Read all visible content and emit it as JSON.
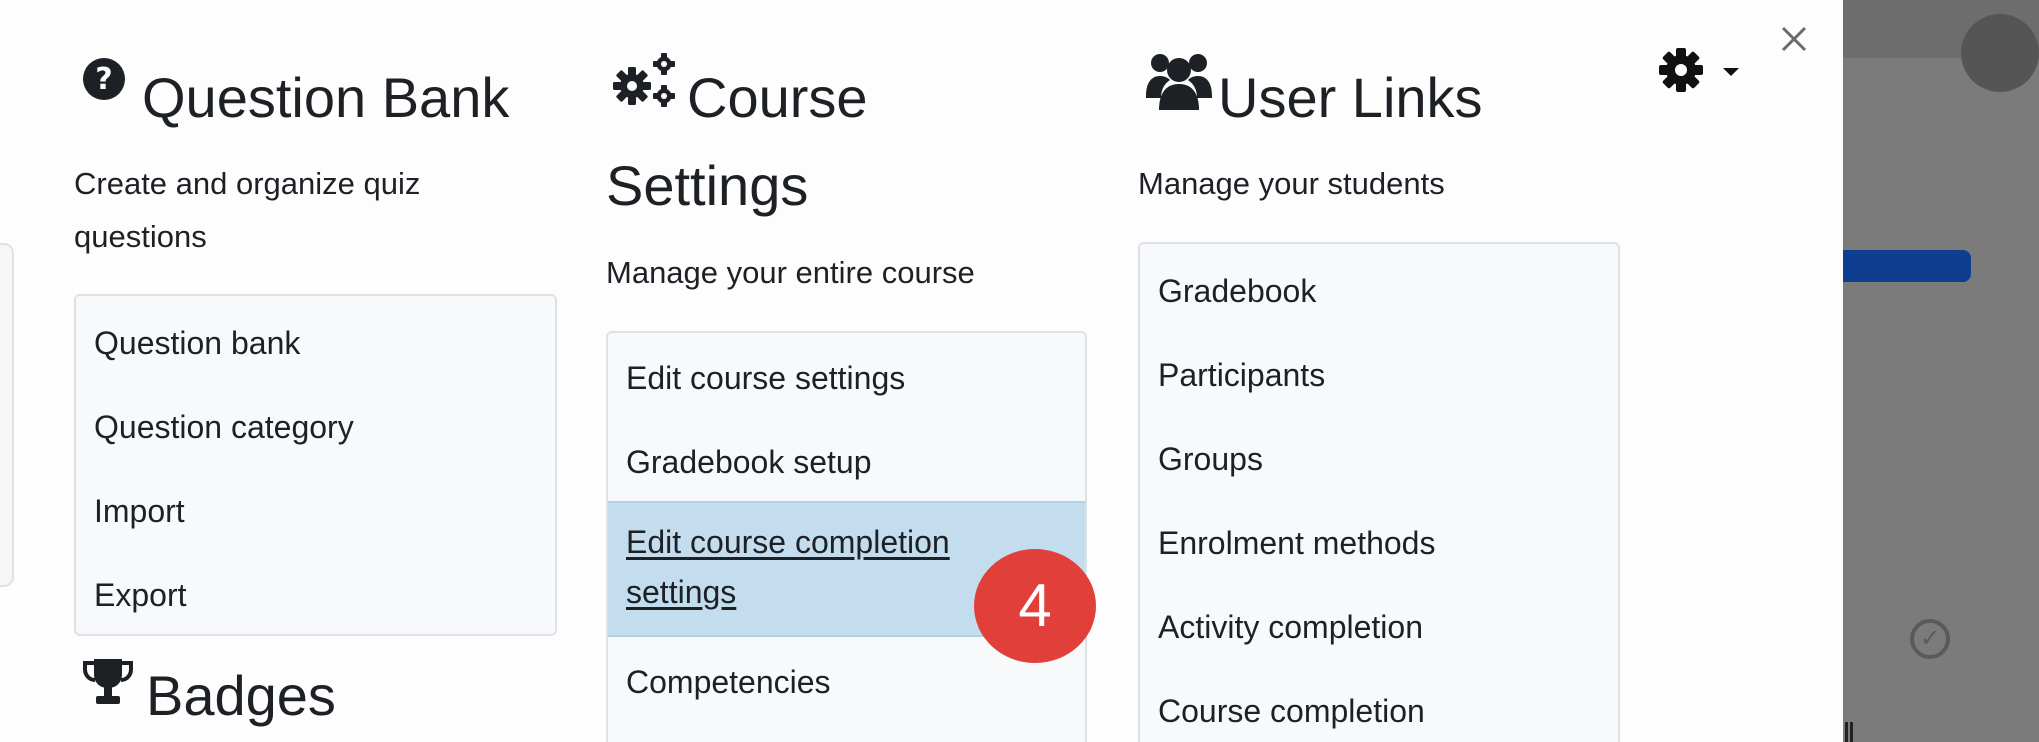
{
  "question_bank": {
    "title": "Question Bank",
    "description": "Create and organize quiz questions",
    "items": [
      "Question bank",
      "Question category",
      "Import",
      "Export"
    ]
  },
  "badges": {
    "title": "Badges"
  },
  "course_settings": {
    "title_line1": "Course",
    "title_line2": "Settings",
    "description": "Manage your entire course",
    "items": [
      "Edit course settings",
      "Gradebook setup",
      "Edit course completion settings",
      "Competencies"
    ],
    "active_index": 2
  },
  "user_links": {
    "title": "User Links",
    "description": "Manage your students",
    "items": [
      "Gradebook",
      "Participants",
      "Groups",
      "Enrolment methods",
      "Activity completion",
      "Course completion"
    ]
  },
  "step_badge": {
    "label": "4",
    "color": "#e1403a"
  },
  "controls": {
    "close_symbol": "×"
  },
  "icons": {
    "question_bank": "question-circle-icon",
    "course": "cogs-icon",
    "user_links": "users-icon",
    "badges": "trophy-icon",
    "settings": "gear-icon"
  }
}
